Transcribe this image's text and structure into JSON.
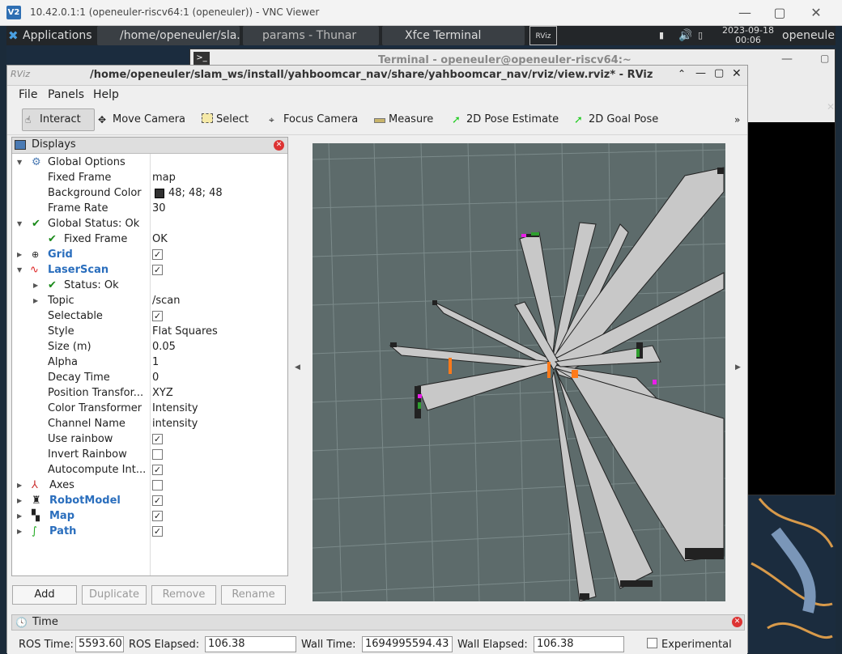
{
  "vnc": {
    "logo": "V2",
    "title": "10.42.0.1:1 (openeuler-riscv64:1 (openeuler)) - VNC Viewer",
    "min": "—",
    "max": "▢",
    "close": "✕"
  },
  "panel": {
    "applications": "Applications",
    "tasks": [
      "/home/openeuler/sla...",
      "params - Thunar",
      "Xfce Terminal"
    ],
    "date": "2023-09-18",
    "time": "00:06",
    "user": "openeuler"
  },
  "terminal": {
    "title": "Terminal - openeuler@openeuler-riscv64:~"
  },
  "rviz": {
    "title": "/home/openeuler/slam_ws/install/yahboomcar_nav/share/yahboomcar_nav/rviz/view.rviz* - RViz",
    "menu": [
      "File",
      "Panels",
      "Help"
    ],
    "tools": [
      "Interact",
      "Move Camera",
      "Select",
      "Focus Camera",
      "Measure",
      "2D Pose Estimate",
      "2D Goal Pose"
    ],
    "displays_title": "Displays",
    "rows": [
      {
        "label": "Global Options",
        "value": ""
      },
      {
        "label": "Fixed Frame",
        "value": "map"
      },
      {
        "label": "Background Color",
        "value": "48; 48; 48"
      },
      {
        "label": "Frame Rate",
        "value": "30"
      },
      {
        "label": "Global Status: Ok",
        "value": ""
      },
      {
        "label": "Fixed Frame",
        "value": "OK"
      },
      {
        "label": "Grid",
        "value": ""
      },
      {
        "label": "LaserScan",
        "value": ""
      },
      {
        "label": "Status: Ok",
        "value": ""
      },
      {
        "label": "Topic",
        "value": "/scan"
      },
      {
        "label": "Selectable",
        "value": ""
      },
      {
        "label": "Style",
        "value": "Flat Squares"
      },
      {
        "label": "Size (m)",
        "value": "0.05"
      },
      {
        "label": "Alpha",
        "value": "1"
      },
      {
        "label": "Decay Time",
        "value": "0"
      },
      {
        "label": "Position Transfor...",
        "value": "XYZ"
      },
      {
        "label": "Color Transformer",
        "value": "Intensity"
      },
      {
        "label": "Channel Name",
        "value": "intensity"
      },
      {
        "label": "Use rainbow",
        "value": ""
      },
      {
        "label": "Invert Rainbow",
        "value": ""
      },
      {
        "label": "Autocompute Int...",
        "value": ""
      },
      {
        "label": "Axes",
        "value": ""
      },
      {
        "label": "RobotModel",
        "value": ""
      },
      {
        "label": "Map",
        "value": ""
      },
      {
        "label": "Path",
        "value": ""
      }
    ],
    "buttons": [
      "Add",
      "Duplicate",
      "Remove",
      "Rename"
    ],
    "time_title": "Time",
    "time": {
      "ros_time_label": "ROS Time:",
      "ros_time": "5593.60",
      "ros_elapsed_label": "ROS Elapsed:",
      "ros_elapsed": "106.38",
      "wall_time_label": "Wall Time:",
      "wall_time": "1694995594.43",
      "wall_elapsed_label": "Wall Elapsed:",
      "wall_elapsed": "106.38",
      "experimental": "Experimental"
    }
  }
}
